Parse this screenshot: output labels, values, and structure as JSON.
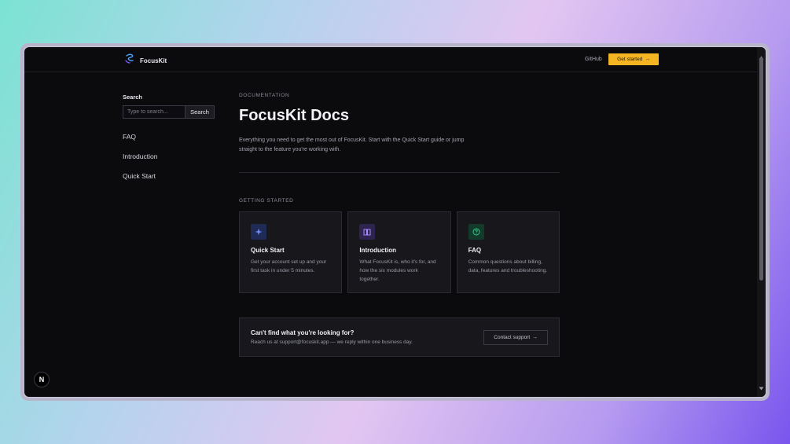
{
  "header": {
    "brand": "FocusKit",
    "github_label": "GitHub",
    "cta_label": "Get started",
    "cta_arrow": "→"
  },
  "sidebar": {
    "search_label": "Search",
    "search_placeholder": "Type to search...",
    "search_value": "",
    "search_button": "Search",
    "items": [
      {
        "label": "FAQ"
      },
      {
        "label": "Introduction"
      },
      {
        "label": "Quick Start"
      }
    ]
  },
  "main": {
    "eyebrow": "DOCUMENTATION",
    "title": "FocusKit Docs",
    "lead": "Everything you need to get the most out of FocusKit. Start with the Quick Start guide or jump straight to the feature you're working with.",
    "section_label": "GETTING STARTED",
    "cards": [
      {
        "icon": "sparkle-icon",
        "title": "Quick Start",
        "desc": "Get your account set up and your first task in under 5 minutes.",
        "icon_color": "#6f8dff",
        "icon_bg": "#1f2a55"
      },
      {
        "icon": "book-icon",
        "title": "Introduction",
        "desc": "What FocusKit is, who it's for, and how the six modules work together.",
        "icon_color": "#a98bff",
        "icon_bg": "#2d2450"
      },
      {
        "icon": "help-circle-icon",
        "title": "FAQ",
        "desc": "Common questions about billing, data, features and troubleshooting.",
        "icon_color": "#34c98a",
        "icon_bg": "#143a2c"
      }
    ],
    "help": {
      "title": "Can't find what you're looking for?",
      "desc": "Reach us at support@focuskit.app — we reply within one business day.",
      "button": "Contact support",
      "button_arrow": "→"
    }
  },
  "colors": {
    "accent": "#f5b523",
    "background": "#0b0b0e",
    "card": "#17171c"
  },
  "badge": {
    "letter": "N"
  }
}
